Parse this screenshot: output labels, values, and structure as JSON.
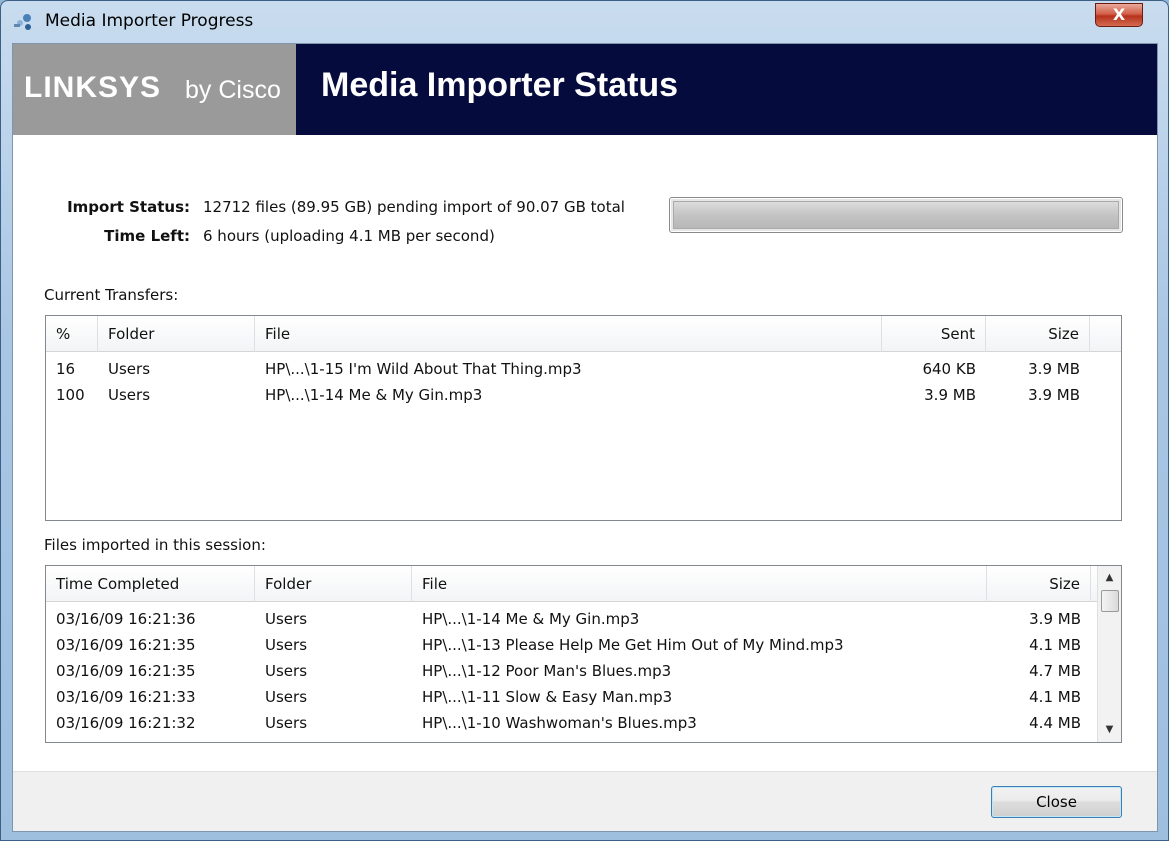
{
  "window": {
    "title": "Media Importer Progress",
    "close_glyph": "X"
  },
  "banner": {
    "logo_brand": "LINKSYS",
    "logo_suffix": "by Cisco",
    "title": "Media Importer Status"
  },
  "status": {
    "import_label": "Import Status:",
    "import_value": "12712 files (89.95 GB) pending import of 90.07 GB total",
    "time_label": "Time Left:",
    "time_value": "6 hours (uploading 4.1 MB per second)",
    "progress_fraction": 0.0
  },
  "current_transfers": {
    "label": "Current Transfers:",
    "columns": [
      "%",
      "Folder",
      "File",
      "Sent",
      "Size"
    ],
    "rows": [
      {
        "pct": "16",
        "folder": "Users",
        "file": "HP\\...\\1-15 I'm Wild About That Thing.mp3",
        "sent": "640 KB",
        "size": "3.9 MB"
      },
      {
        "pct": "100",
        "folder": "Users",
        "file": "HP\\...\\1-14 Me & My Gin.mp3",
        "sent": "3.9 MB",
        "size": "3.9 MB"
      }
    ]
  },
  "session": {
    "label": "Files imported in this session:",
    "columns": [
      "Time Completed",
      "Folder",
      "File",
      "Size"
    ],
    "rows": [
      {
        "time": "03/16/09 16:21:36",
        "folder": "Users",
        "file": "HP\\...\\1-14 Me & My Gin.mp3",
        "size": "3.9 MB"
      },
      {
        "time": "03/16/09 16:21:35",
        "folder": "Users",
        "file": "HP\\...\\1-13 Please Help Me Get Him Out of My Mind.mp3",
        "size": "4.1 MB"
      },
      {
        "time": "03/16/09 16:21:35",
        "folder": "Users",
        "file": "HP\\...\\1-12 Poor Man's Blues.mp3",
        "size": "4.7 MB"
      },
      {
        "time": "03/16/09 16:21:33",
        "folder": "Users",
        "file": "HP\\...\\1-11 Slow & Easy Man.mp3",
        "size": "4.1 MB"
      },
      {
        "time": "03/16/09 16:21:32",
        "folder": "Users",
        "file": "HP\\...\\1-10 Washwoman's Blues.mp3",
        "size": "4.4 MB"
      }
    ]
  },
  "footer": {
    "close_label": "Close"
  },
  "icons": {
    "app": "media-importer-icon",
    "scroll_up": "arrow-up-icon",
    "scroll_down": "arrow-down-icon"
  },
  "colors": {
    "banner_dark": "#060b3d",
    "logo_gray": "#9a9a9a",
    "progress_green": "#37c53b"
  }
}
